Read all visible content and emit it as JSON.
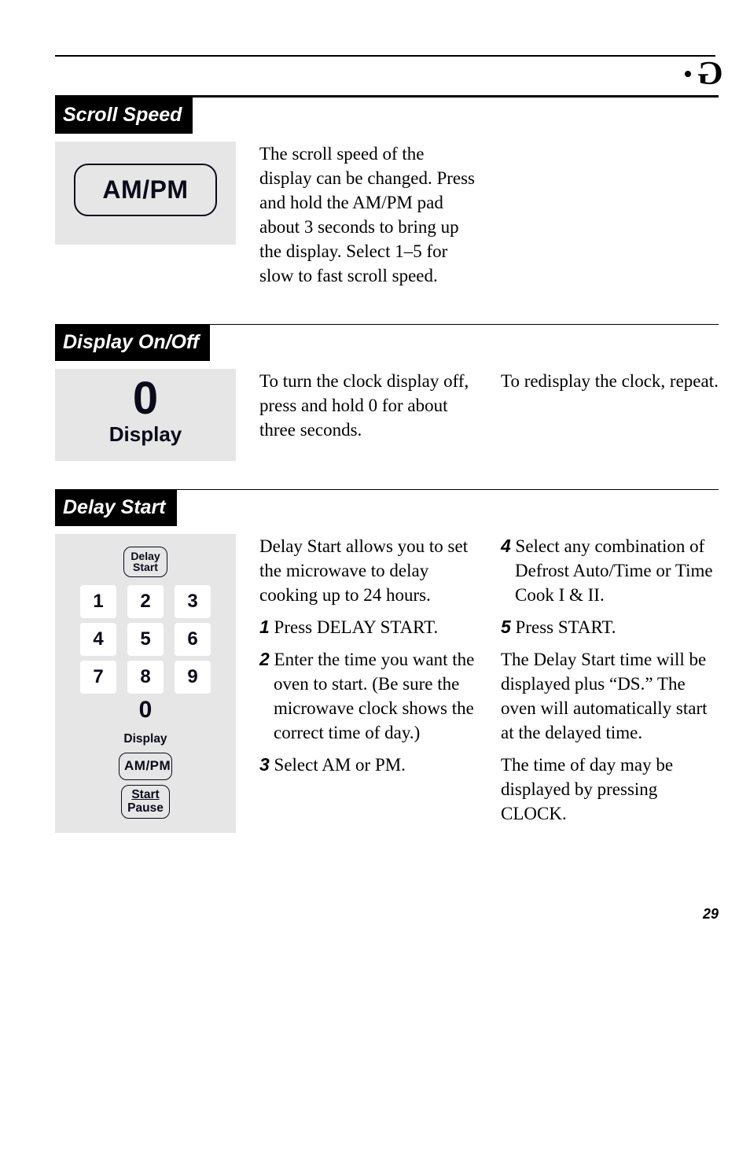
{
  "page_number": "29",
  "sections": {
    "scroll_speed": {
      "heading": "Scroll Speed",
      "illus": {
        "ampm_label": "AM/PM"
      },
      "body": "The scroll speed of the display can be changed. Press and hold the AM/PM pad about 3 seconds to bring up the display. Select 1–5 for slow to fast scroll speed."
    },
    "display_onoff": {
      "heading": "Display On/Off",
      "illus": {
        "zero": "0",
        "display_label": "Display"
      },
      "col1": "To turn the clock display off, press and hold 0 for about three seconds.",
      "col2": "To redisplay the clock, repeat."
    },
    "delay_start": {
      "heading": "Delay Start",
      "illus": {
        "delay_label_top": "Delay",
        "delay_label_bottom": "Start",
        "keys": [
          "1",
          "2",
          "3",
          "4",
          "5",
          "6",
          "7",
          "8",
          "9"
        ],
        "zero": "0",
        "display_label": "Display",
        "ampm_label": "AM/PM",
        "start_top": "Start",
        "start_bottom": "Pause"
      },
      "intro": "Delay Start allows you to set the microwave to delay cooking up to 24 hours.",
      "step1_num": "1",
      "step1_text": " Press DELAY START.",
      "step2_num": "2",
      "step2_text": " Enter the time you want the oven to start. (Be sure the microwave clock shows the correct time of day.)",
      "step3_num": "3",
      "step3_text": " Select AM or PM.",
      "step4_num": "4",
      "step4_text": " Select any combination of Defrost Auto/Time or Time Cook I & II.",
      "step5_num": "5",
      "step5_text": " Press START.",
      "para_a": "The Delay Start time will be displayed plus “DS.” The oven will automatically start at the delayed time.",
      "para_b": "The time of day may be displayed by pressing CLOCK."
    }
  }
}
